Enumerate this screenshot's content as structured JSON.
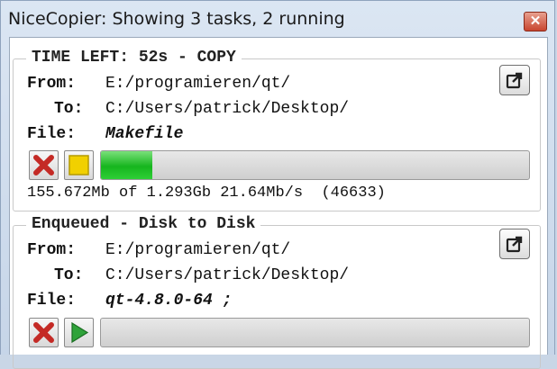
{
  "window": {
    "title": "NiceCopier: Showing 3 tasks, 2 running",
    "close_symbol": "✕"
  },
  "labels": {
    "from": "From:",
    "to": "To:",
    "file": "File:"
  },
  "tasks": [
    {
      "header": "TIME LEFT: 52s - COPY",
      "from": "E:/programieren/qt/",
      "to": "C:/Users/patrick/Desktop/",
      "file": "Makefile",
      "progress": 0.12,
      "status": "155.672Mb of 1.293Gb 21.64Mb/s  (46633)",
      "buttons": [
        "cancel-icon",
        "pause-icon"
      ]
    },
    {
      "header": "Enqueued - Disk to Disk",
      "from": "E:/programieren/qt/",
      "to": "C:/Users/patrick/Desktop/",
      "file": "qt-4.8.0-64 ;",
      "progress": 0,
      "buttons": [
        "cancel-icon",
        "play-icon"
      ]
    }
  ],
  "colors": {
    "progress_green": "#16b51e",
    "cancel_red": "#d0312d",
    "pause_yellow": "#f1d000",
    "play_green": "#2fa33a"
  }
}
